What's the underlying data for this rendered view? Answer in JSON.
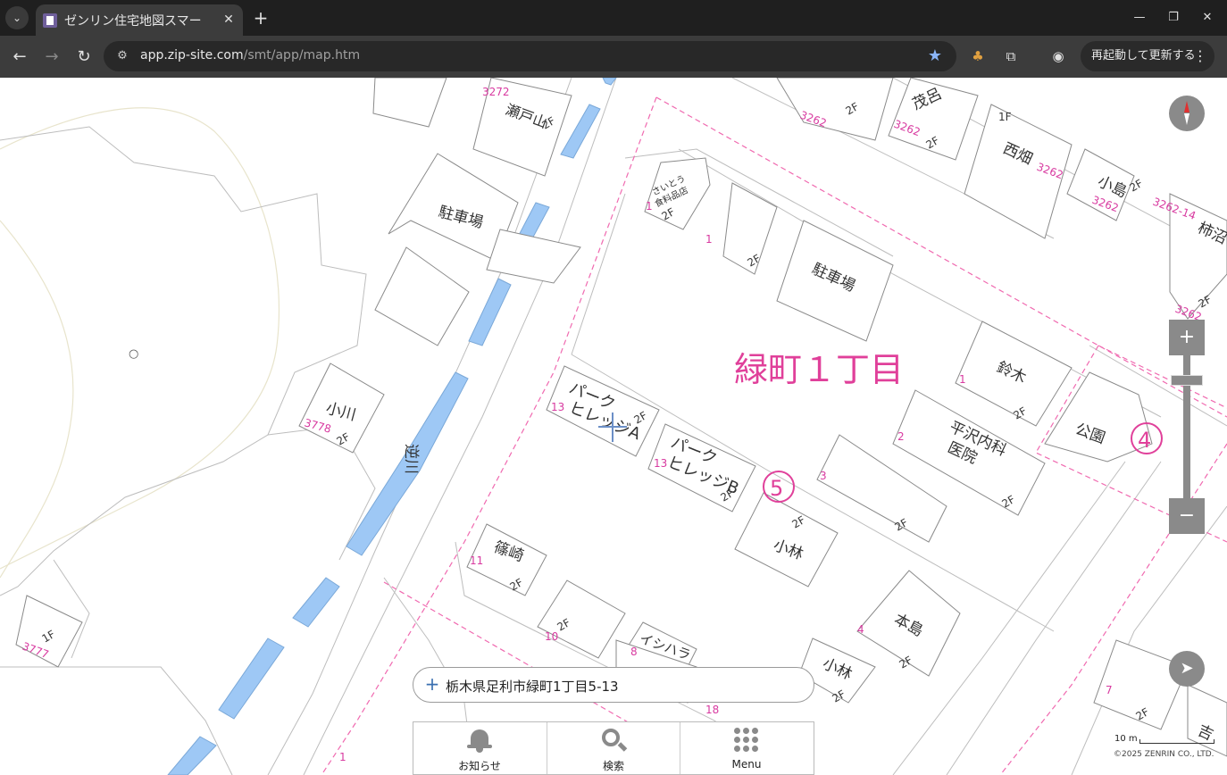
{
  "browser": {
    "tab_title": "ゼンリン住宅地図スマー",
    "url_host": "app.zip-site.com",
    "url_path": "/smt/app/map.htm",
    "restart_label": "再起動して更新する"
  },
  "map": {
    "district_label": "緑町１丁目",
    "block_numbers": [
      "④",
      "⑤"
    ],
    "river_label": "逆川",
    "buildings": [
      {
        "name": "瀬戸山",
        "lot": "3272",
        "floors": "2F"
      },
      {
        "name": "駐車場"
      },
      {
        "name": "小川",
        "lot": "3778",
        "floors": "2F"
      },
      {
        "name": "パークヒレッジA",
        "lot": "13",
        "floors": "2F"
      },
      {
        "name": "パークヒレッジB",
        "lot": "13",
        "floors": "2F"
      },
      {
        "name": "篠崎",
        "lot": "11",
        "floors": "2F"
      },
      {
        "name": "小林",
        "floors": "2F"
      },
      {
        "name": "本島",
        "lot": "4",
        "floors": "2F"
      },
      {
        "name": "小林",
        "floors": "2F"
      },
      {
        "name": "イシハラ",
        "lot": "8"
      },
      {
        "name": "鈴木",
        "lot": "1",
        "floors": "2F"
      },
      {
        "name": "平沢内科医院",
        "lot": "2",
        "floors": "2F"
      },
      {
        "name": "公園"
      },
      {
        "name": "茂呂",
        "lot": "3262",
        "floors": "2F"
      },
      {
        "name": "西畑",
        "lot": "3262",
        "floors": "1F"
      },
      {
        "name": "小島",
        "lot": "3262",
        "floors": "2F"
      },
      {
        "name": "柿沼",
        "lot": "3262-14"
      },
      {
        "name": "駐車場"
      },
      {
        "name": "さいとう食料品店",
        "lot": "1",
        "floors": "2F"
      }
    ],
    "misc_labels": {
      "floor_1f": "1F",
      "lot_3777": "3777",
      "lot_10": "10",
      "lot_18": "18",
      "lot_7": "7",
      "lot_3": "3",
      "yoshi": "吉"
    }
  },
  "controls": {
    "zoom_in": "+",
    "zoom_out": "−"
  },
  "address": {
    "text": "栃木県足利市緑町1丁目5-13"
  },
  "bottom_menu": [
    {
      "label": "お知らせ",
      "icon": "bell-icon"
    },
    {
      "label": "検索",
      "icon": "search-icon"
    },
    {
      "label": "Menu",
      "icon": "grid-icon"
    }
  ],
  "scale": {
    "label": "10 m"
  },
  "copyright": "©2025 ZENRIN CO., LTD."
}
